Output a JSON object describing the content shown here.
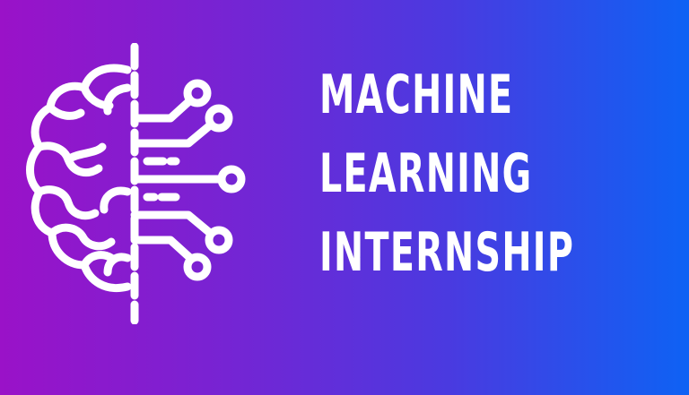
{
  "title_lines": [
    "MACHINE",
    "LEARNING",
    "INTERNSHIP"
  ],
  "icon": "brain-circuit-icon",
  "colors": {
    "gradient_left": "#9a12c8",
    "gradient_right": "#0e62f4",
    "foreground": "#ffffff"
  }
}
